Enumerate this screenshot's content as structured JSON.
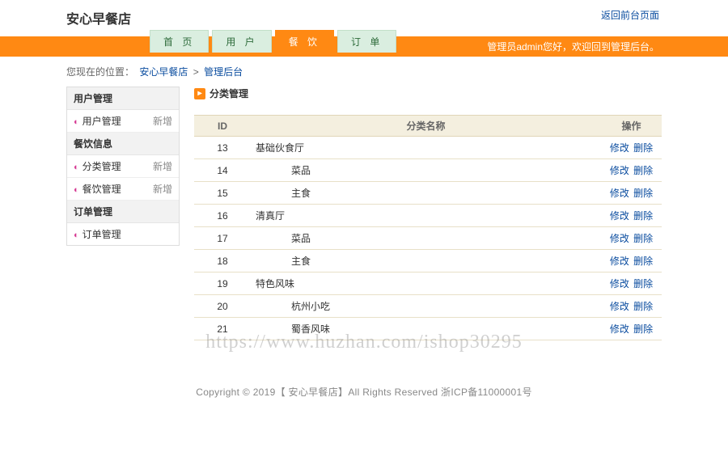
{
  "header": {
    "site_title": "安心早餐店",
    "top_link": "返回前台页面"
  },
  "nav": {
    "items": [
      {
        "label": "首 页",
        "active": false
      },
      {
        "label": "用 户",
        "active": false
      },
      {
        "label": "餐 饮",
        "active": true
      },
      {
        "label": "订 单",
        "active": false
      }
    ]
  },
  "status_bar": "管理员admin您好，欢迎回到管理后台。",
  "breadcrumb": {
    "prefix": "您现在的位置：",
    "links": [
      "安心早餐店",
      "管理后台"
    ]
  },
  "sidebar": {
    "groups": [
      {
        "title": "用户管理",
        "items": [
          {
            "label": "用户管理",
            "extra": "新增"
          }
        ]
      },
      {
        "title": "餐饮信息",
        "items": [
          {
            "label": "分类管理",
            "extra": "新增"
          },
          {
            "label": "餐饮管理",
            "extra": "新增"
          }
        ]
      },
      {
        "title": "订单管理",
        "items": [
          {
            "label": "订单管理",
            "extra": ""
          }
        ]
      }
    ]
  },
  "panel": {
    "title": "分类管理",
    "columns": {
      "id": "ID",
      "name": "分类名称",
      "ops": "操作"
    },
    "ops": {
      "edit": "修改",
      "delete": "删除"
    },
    "rows": [
      {
        "id": "13",
        "name": "基础伙食厅",
        "indent": 0
      },
      {
        "id": "14",
        "name": "菜品",
        "indent": 1
      },
      {
        "id": "15",
        "name": "主食",
        "indent": 1
      },
      {
        "id": "16",
        "name": "清真厅",
        "indent": 0
      },
      {
        "id": "17",
        "name": "菜品",
        "indent": 1
      },
      {
        "id": "18",
        "name": "主食",
        "indent": 1
      },
      {
        "id": "19",
        "name": "特色风味",
        "indent": 0
      },
      {
        "id": "20",
        "name": "杭州小吃",
        "indent": 1
      },
      {
        "id": "21",
        "name": "蜀香风味",
        "indent": 1
      }
    ]
  },
  "footer": "Copyright © 2019【 安心早餐店】All Rights Reserved   浙ICP备11000001号",
  "watermark": "https://www.huzhan.com/ishop30295"
}
